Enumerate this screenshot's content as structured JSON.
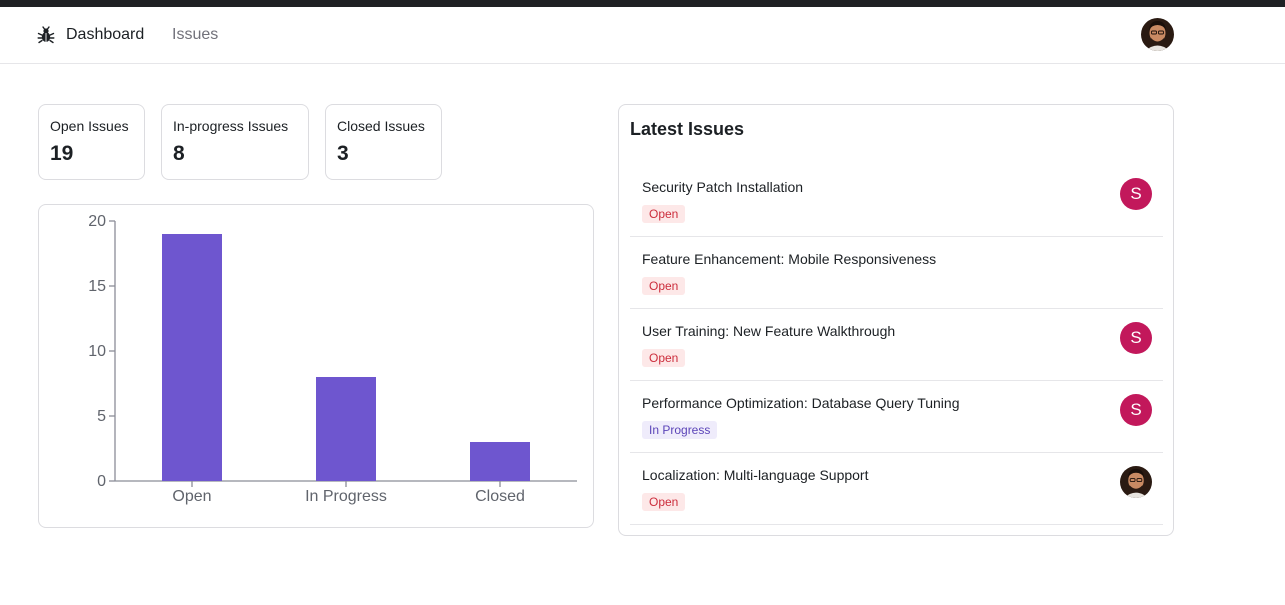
{
  "nav": {
    "logo_icon": "bug-icon",
    "links": [
      "Dashboard",
      "Issues"
    ],
    "active": "Dashboard",
    "avatar_icon": "user-photo-avatar"
  },
  "summary": [
    {
      "label": "Open Issues",
      "value": "19"
    },
    {
      "label": "In-progress Issues",
      "value": "8"
    },
    {
      "label": "Closed Issues",
      "value": "3"
    }
  ],
  "colors": {
    "bar": "#6e56cf",
    "open_badge_bg": "#fde8e8",
    "open_badge_text": "#cc2d3c",
    "progress_badge_bg": "#efecfb",
    "progress_badge_text": "#5b44b8",
    "avatar_bg": "#c2185b"
  },
  "chart_data": {
    "type": "bar",
    "categories": [
      "Open",
      "In Progress",
      "Closed"
    ],
    "values": [
      19,
      8,
      3
    ],
    "ylim": [
      0,
      20
    ],
    "yticks": [
      0,
      5,
      10,
      15,
      20
    ],
    "grid": false
  },
  "latest": {
    "title": "Latest Issues",
    "issues": [
      {
        "title": "Security Patch Installation",
        "status": "Open",
        "assignee": "S"
      },
      {
        "title": "Feature Enhancement: Mobile Responsiveness",
        "status": "Open",
        "assignee": ""
      },
      {
        "title": "User Training: New Feature Walkthrough",
        "status": "Open",
        "assignee": "S"
      },
      {
        "title": "Performance Optimization: Database Query Tuning",
        "status": "In Progress",
        "assignee": "S"
      },
      {
        "title": "Localization: Multi-language Support",
        "status": "Open",
        "assignee": "photo"
      }
    ]
  }
}
